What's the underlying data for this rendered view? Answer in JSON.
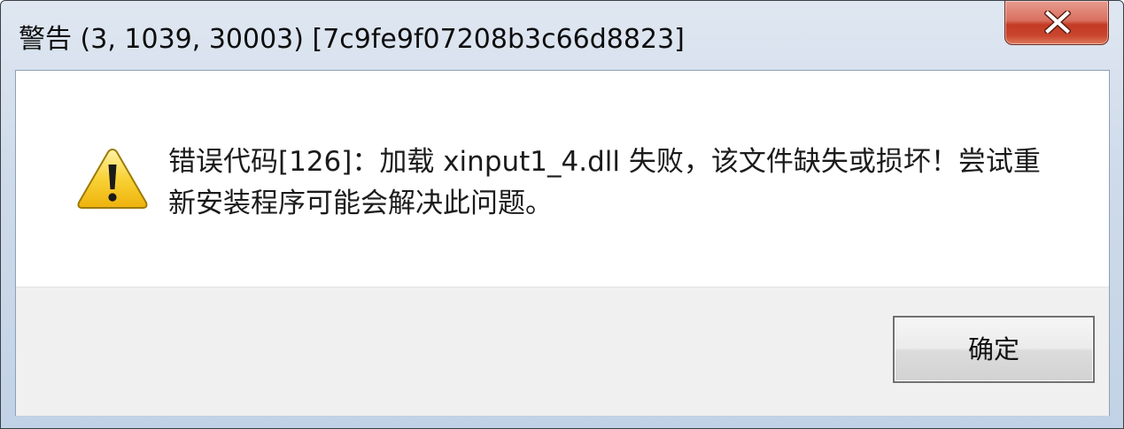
{
  "window": {
    "title": "警告 (3, 1039, 30003) [7c9fe9f07208b3c66d8823]",
    "close_icon": "close-icon"
  },
  "dialog": {
    "icon": "warning-icon",
    "message": "错误代码[126]：加载 xinput1_4.dll 失败，该文件缺失或损坏！尝试重新安装程序可能会解决此问题。"
  },
  "buttons": {
    "ok_label": "确定"
  },
  "colors": {
    "close_button": "#c9452e",
    "warning_yellow": "#f5c518",
    "title_bar": "#cfdbea"
  }
}
